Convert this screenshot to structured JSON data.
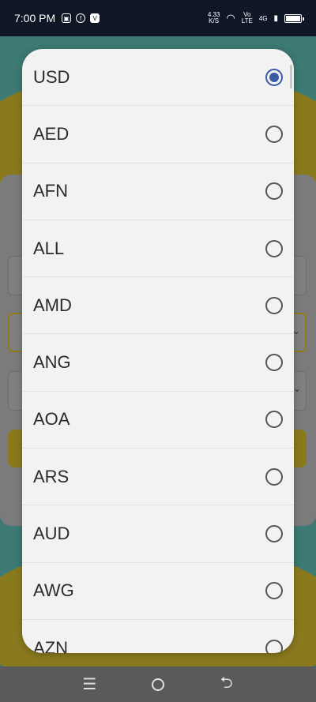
{
  "status_bar": {
    "time": "7:00 PM",
    "left_icons": [
      "sim-icon",
      "facebook-icon",
      "v-app-icon"
    ],
    "net_speed_value": "4.33",
    "net_speed_unit": "K/S",
    "volte_top": "Vo",
    "volte_bottom": "LTE",
    "network": "4G"
  },
  "currency_dialog": {
    "selected": "USD",
    "options": [
      {
        "code": "USD",
        "selected": true
      },
      {
        "code": "AED",
        "selected": false
      },
      {
        "code": "AFN",
        "selected": false
      },
      {
        "code": "ALL",
        "selected": false
      },
      {
        "code": "AMD",
        "selected": false
      },
      {
        "code": "ANG",
        "selected": false
      },
      {
        "code": "AOA",
        "selected": false
      },
      {
        "code": "ARS",
        "selected": false
      },
      {
        "code": "AUD",
        "selected": false
      },
      {
        "code": "AWG",
        "selected": false
      },
      {
        "code": "AZN",
        "selected": false
      }
    ]
  },
  "nav_bar": {
    "icons": [
      "menu-icon",
      "home-icon",
      "back-icon"
    ]
  },
  "colors": {
    "accent": "#3b5aa6",
    "status_bar_bg": "#0f1626",
    "dialog_bg": "#f2f2f2"
  }
}
